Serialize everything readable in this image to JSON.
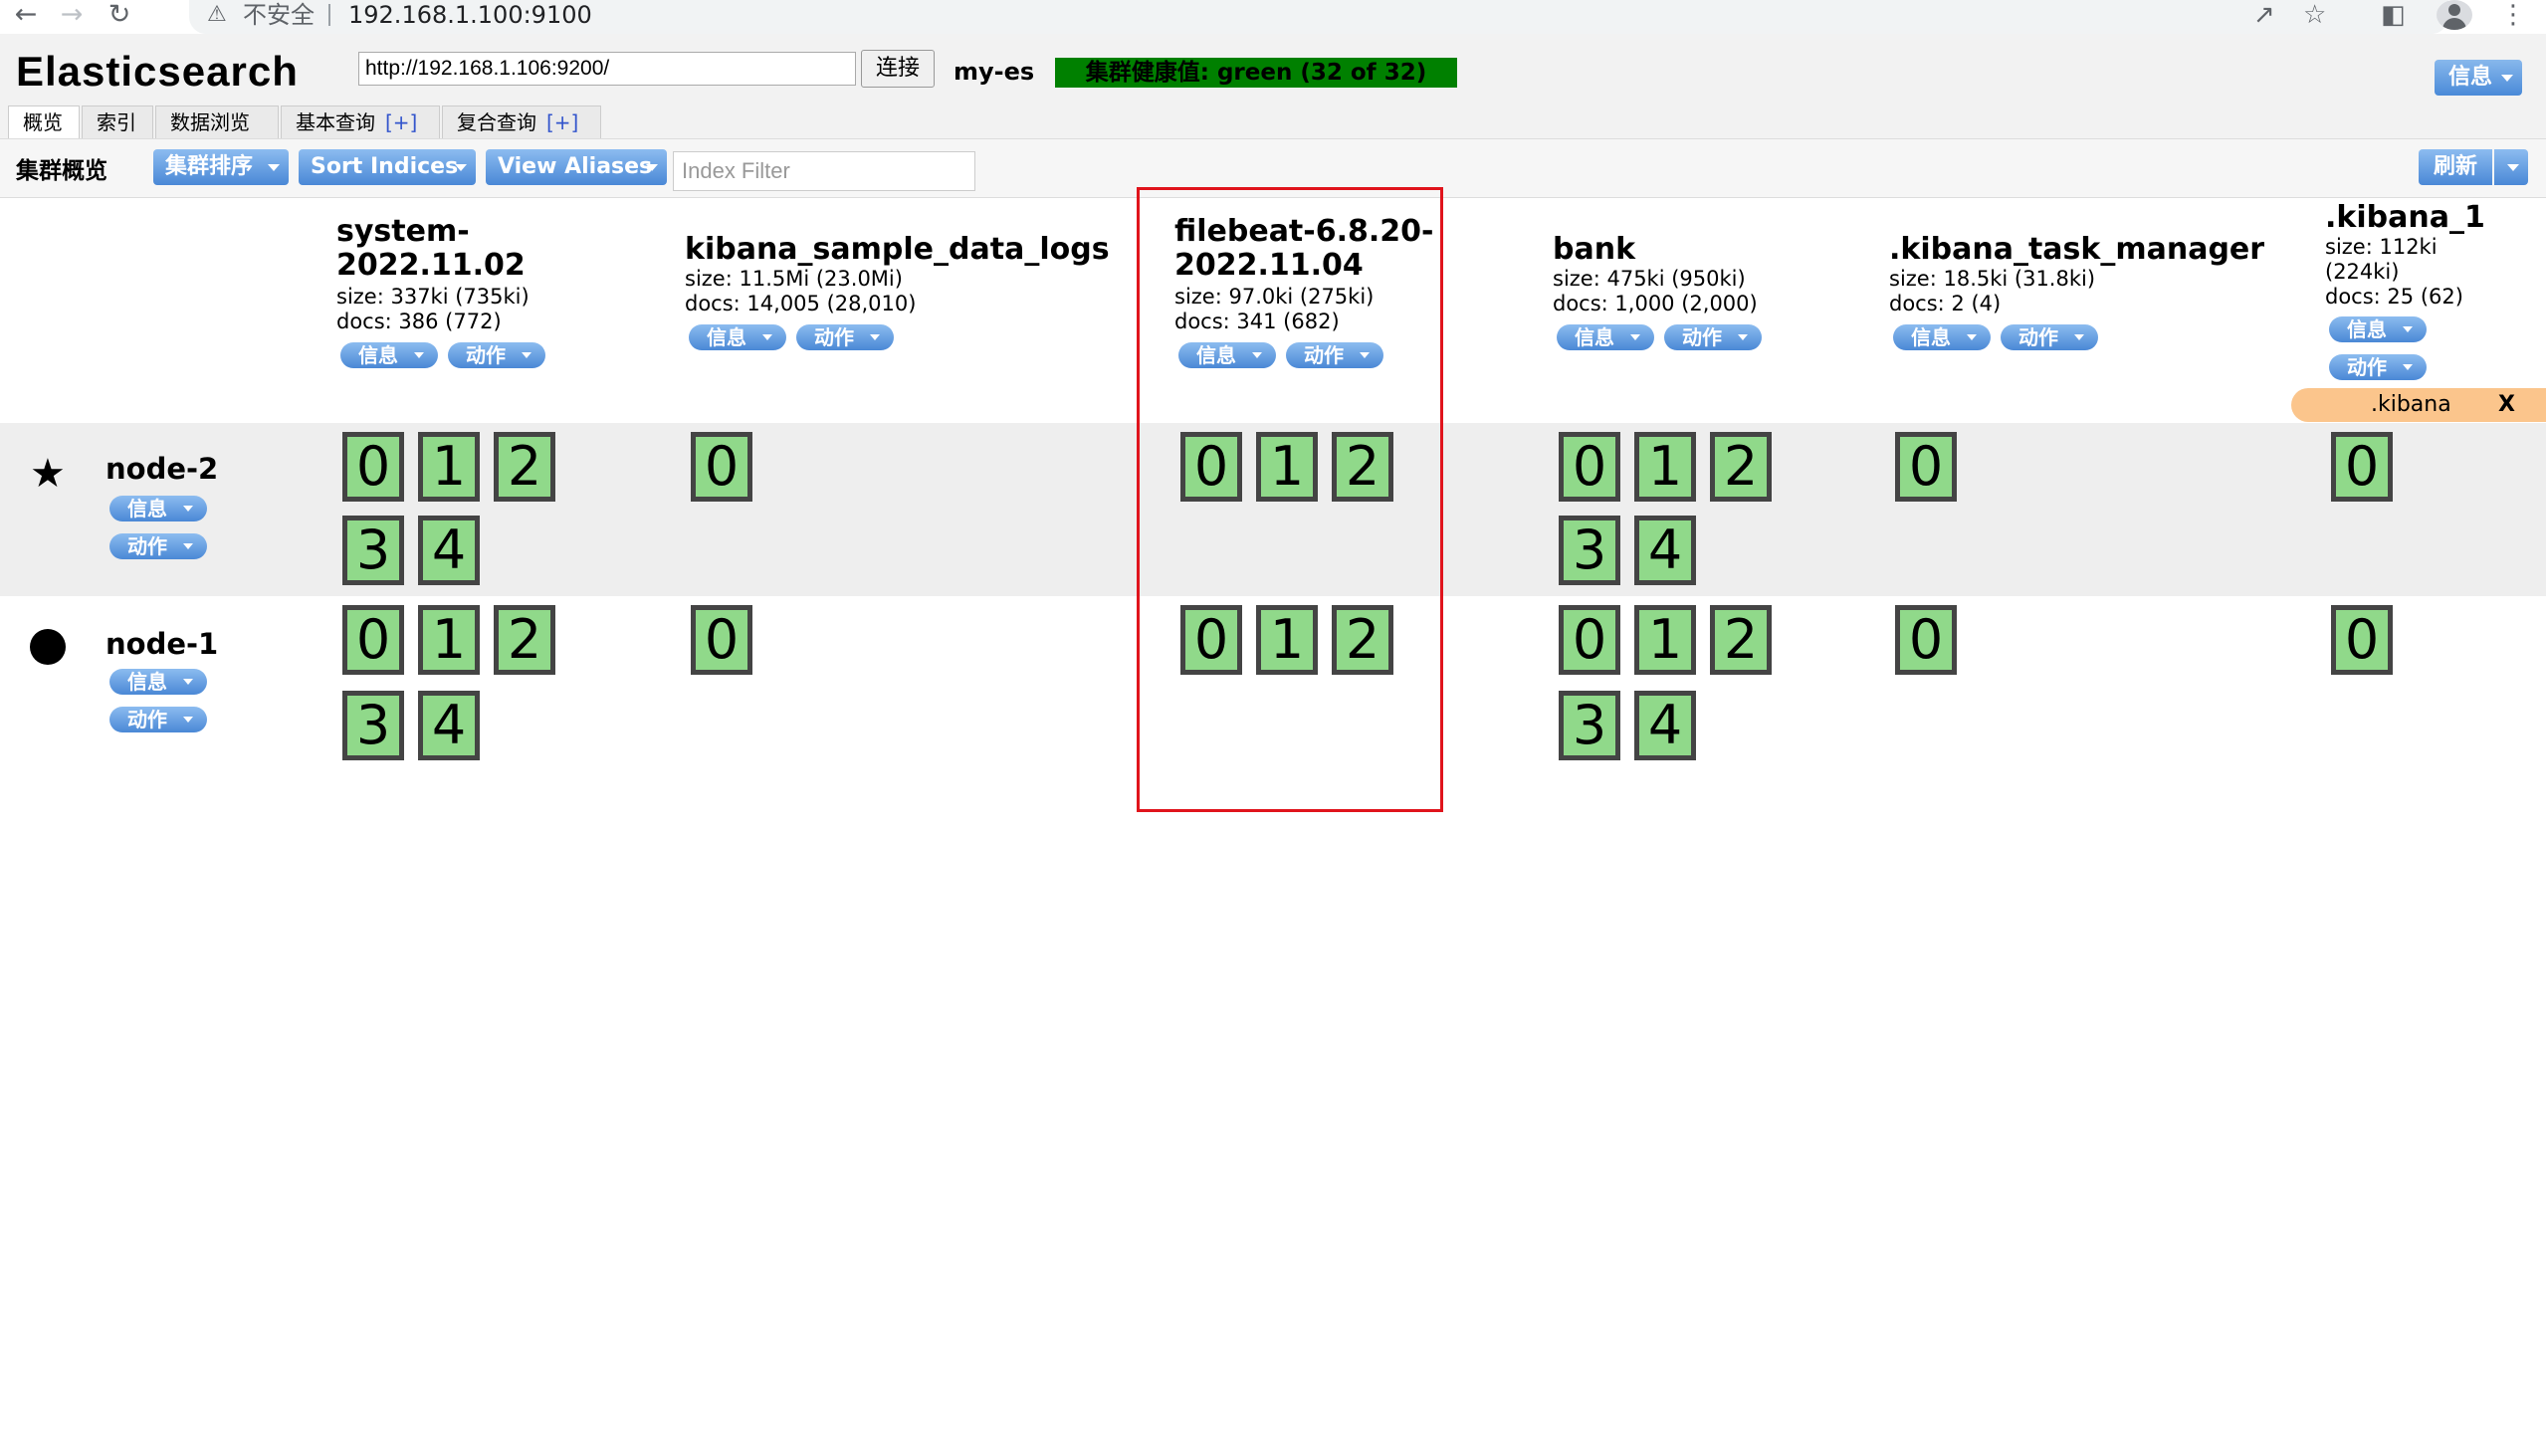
{
  "browser": {
    "insecure_label": "不安全",
    "url": "192.168.1.100:9100"
  },
  "app": {
    "title": "Elasticsearch",
    "connect_url": "http://192.168.1.106:9200/",
    "connect_label": "连接",
    "cluster_name": "my-es",
    "health_text": "集群健康值: green (32 of 32)",
    "health_color": "#008000",
    "info_label": "信息"
  },
  "tabs": [
    {
      "label": "概览"
    },
    {
      "label": "索引"
    },
    {
      "label": "数据浏览"
    },
    {
      "label": "基本查询",
      "extra": "[+]"
    },
    {
      "label": "复合查询",
      "extra": "[+]"
    }
  ],
  "toolbar": {
    "title": "集群概览",
    "sort_cluster": "集群排序",
    "sort_indices": "Sort Indices",
    "view_aliases": "View Aliases",
    "filter_placeholder": "Index Filter",
    "refresh": "刷新"
  },
  "pill": {
    "info": "信息",
    "action": "动作"
  },
  "indices": [
    {
      "name_lines": [
        "system-",
        "2022.11.02"
      ],
      "size": "size: 337ki (735ki)",
      "docs": "docs: 386 (772)"
    },
    {
      "name_lines": [
        "kibana_sample_data_logs"
      ],
      "size": "size: 11.5Mi (23.0Mi)",
      "docs": "docs: 14,005 (28,010)"
    },
    {
      "name_lines": [
        "filebeat-6.8.20-",
        "2022.11.04"
      ],
      "size": "size: 97.0ki (275ki)",
      "docs": "docs: 341 (682)"
    },
    {
      "name_lines": [
        "bank"
      ],
      "size": "size: 475ki (950ki)",
      "docs": "docs: 1,000 (2,000)"
    },
    {
      "name_lines": [
        ".kibana_task_manager"
      ],
      "size": "size: 18.5ki (31.8ki)",
      "docs": "docs: 2 (4)"
    },
    {
      "name_lines": [
        ".kibana_1"
      ],
      "size_lines": [
        "size: 112ki",
        "(224ki)"
      ],
      "docs": "docs: 25 (62)",
      "alias": ".kibana",
      "alias_close": "X"
    }
  ],
  "nodes": [
    {
      "name": "node-2",
      "icon": "star-icon",
      "master": true
    },
    {
      "name": "node-1",
      "icon": "circle-icon",
      "master": false
    }
  ],
  "shards": {
    "node-2": [
      [
        "0",
        "1",
        "2",
        "3",
        "4"
      ],
      [
        "0"
      ],
      [
        "0",
        "1",
        "2"
      ],
      [
        "0",
        "1",
        "2",
        "3",
        "4"
      ],
      [
        "0"
      ],
      [
        "0"
      ]
    ],
    "node-1": [
      [
        "0",
        "1",
        "2",
        "3",
        "4"
      ],
      [
        "0"
      ],
      [
        "0",
        "1",
        "2"
      ],
      [
        "0",
        "1",
        "2",
        "3",
        "4"
      ],
      [
        "0"
      ],
      [
        "0"
      ]
    ]
  },
  "colors": {
    "shard_fill": "#90d98a",
    "accent_button": "#4a88d6",
    "highlight_border": "#e0141c",
    "alias_bg": "#fbc58c"
  }
}
